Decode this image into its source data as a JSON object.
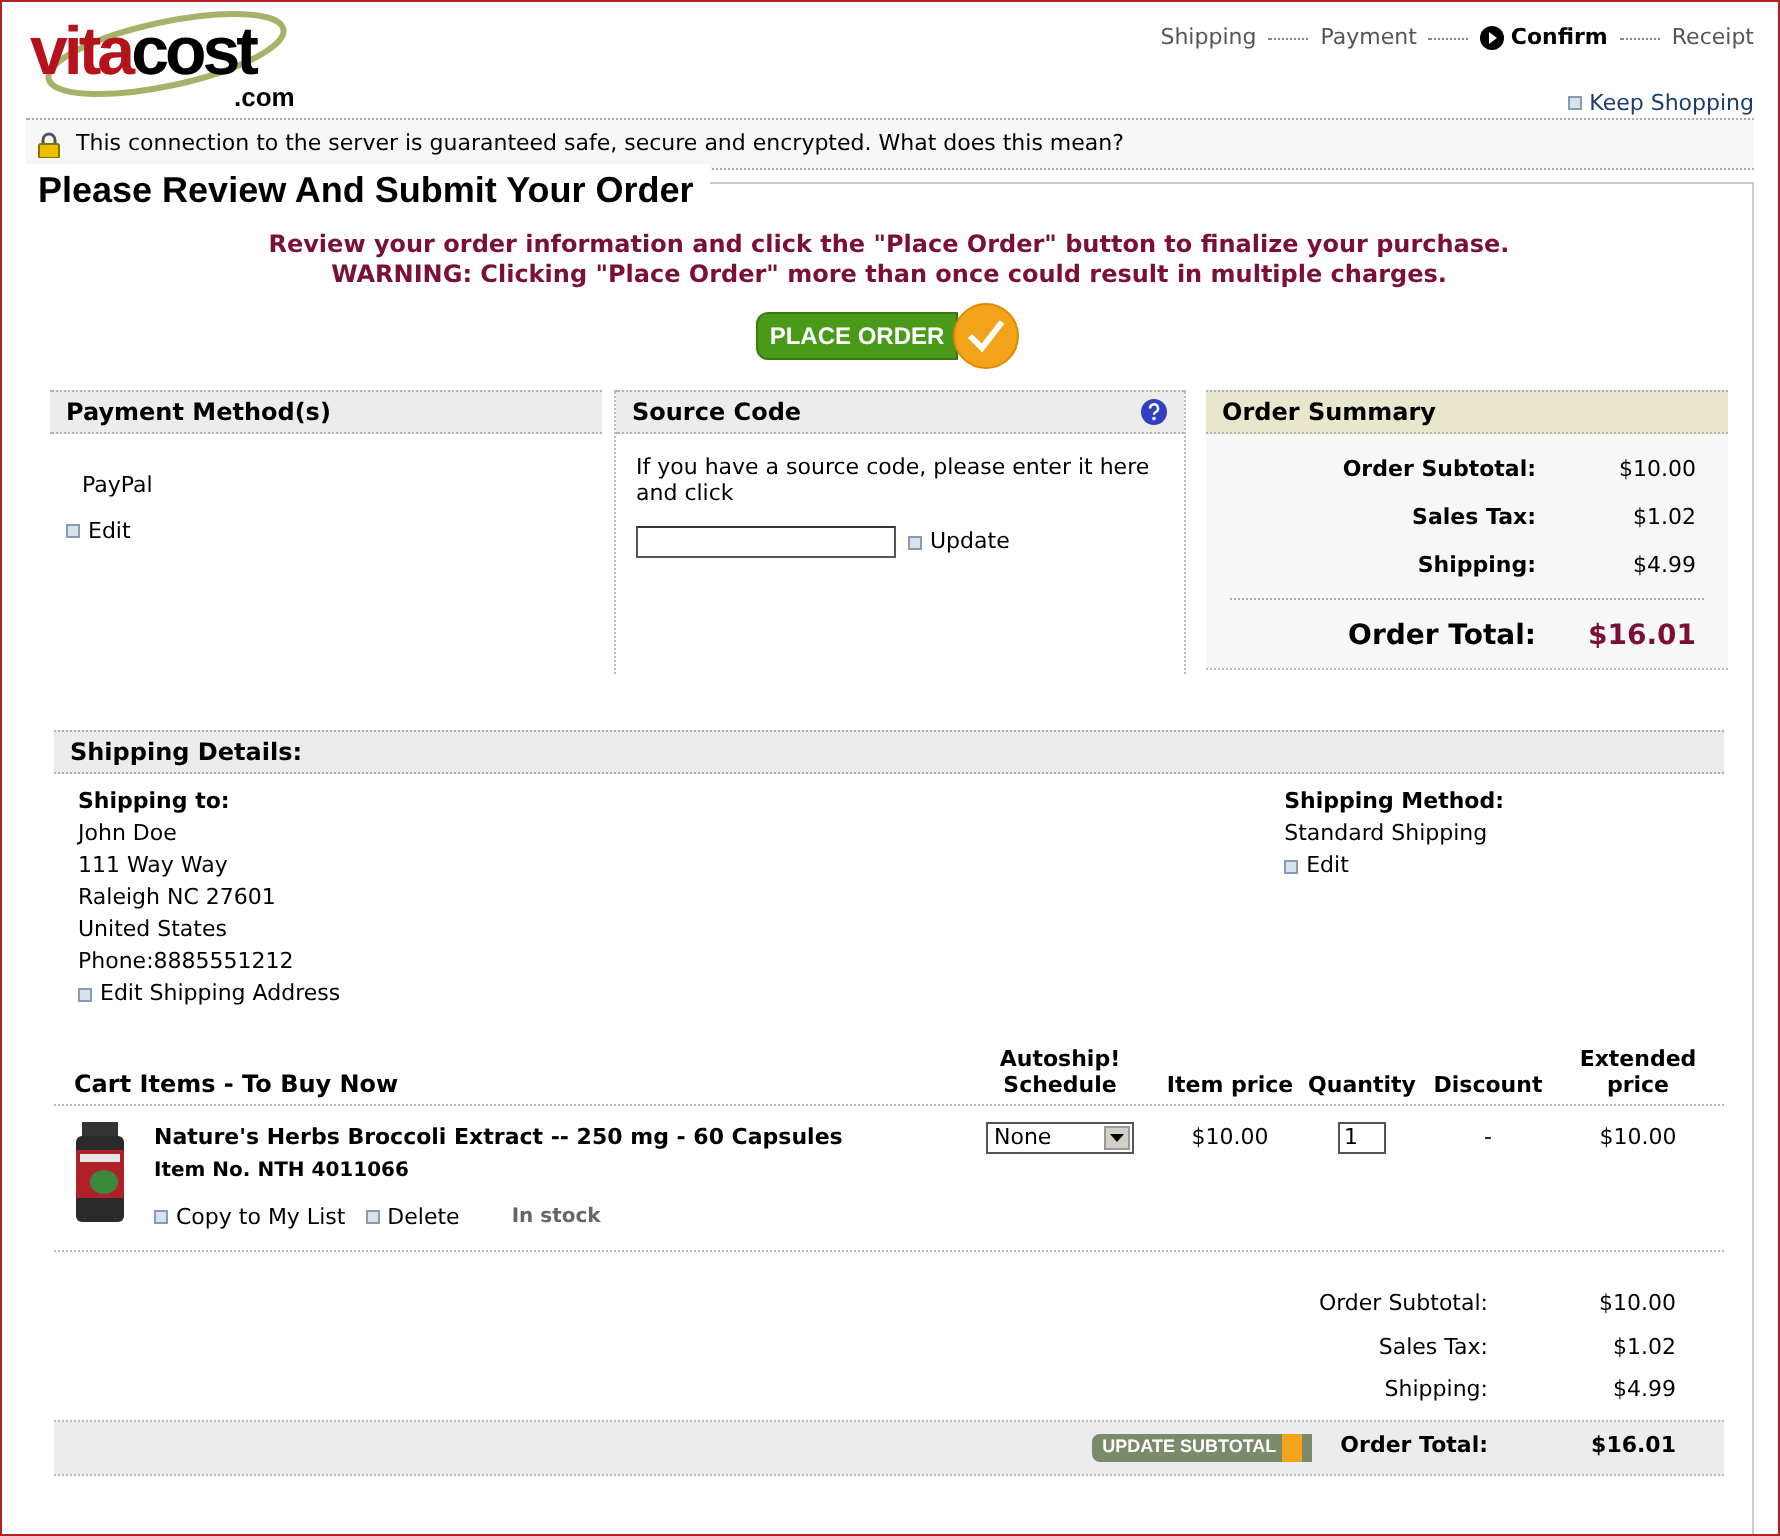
{
  "logo": {
    "first": "vita",
    "second": "cost",
    "suffix": ".com"
  },
  "steps": [
    {
      "label": "Shipping",
      "selected": false
    },
    {
      "label": "Payment",
      "selected": false
    },
    {
      "label": "Confirm",
      "selected": true
    },
    {
      "label": "Receipt",
      "selected": false
    }
  ],
  "keep_shopping": "Keep Shopping",
  "security_notice": "This connection to the server is guaranteed safe, secure and encrypted. What does this mean?",
  "title": "Please Review And Submit Your Order",
  "instructions": [
    "Review your order information and click the \"Place Order\" button to finalize your purchase.",
    "WARNING: Clicking \"Place Order\" more than once could result in multiple charges."
  ],
  "place_order": "PLACE ORDER",
  "payment": {
    "heading": "Payment Method(s)",
    "method": "PayPal",
    "edit": "Edit"
  },
  "source_code": {
    "heading": "Source Code",
    "help": "If you have a source code, please enter it here and click",
    "update": "Update"
  },
  "order_summary": {
    "heading": "Order Summary",
    "rows": [
      {
        "label": "Order Subtotal:",
        "value": "$10.00"
      },
      {
        "label": "Sales Tax:",
        "value": "$1.02"
      },
      {
        "label": "Shipping:",
        "value": "$4.99"
      }
    ],
    "total_label": "Order Total:",
    "total": "$16.01"
  },
  "shipping_details": {
    "heading": "Shipping Details:",
    "to_heading": "Shipping to:",
    "address": [
      "John Doe",
      "111 Way Way",
      "Raleigh NC 27601",
      "United States",
      "Phone:8885551212"
    ],
    "edit_address": "Edit Shipping Address",
    "method_heading": "Shipping Method:",
    "method": "Standard Shipping",
    "edit": "Edit"
  },
  "cart": {
    "heading": "Cart Items - To Buy Now",
    "columns": [
      "Autoship! Schedule",
      "Item price",
      "Quantity",
      "Discount",
      "Extended price"
    ],
    "items": [
      {
        "name": "Nature's Herbs Broccoli Extract -- 250 mg - 60 Capsules",
        "item_no": "Item No. NTH 4011066",
        "copy": "Copy to My List",
        "delete": "Delete",
        "stock": "In stock",
        "autoship": "None",
        "price": "$10.00",
        "quantity": "1",
        "discount": "-",
        "extended": "$10.00"
      }
    ],
    "totals": [
      {
        "label": "Order Subtotal:",
        "value": "$10.00"
      },
      {
        "label": "Sales Tax:",
        "value": "$1.02"
      },
      {
        "label": "Shipping:",
        "value": "$4.99"
      }
    ],
    "update_subtotal": "UPDATE SUBTOTAL",
    "total_label": "Order Total:",
    "total": "$16.01"
  }
}
